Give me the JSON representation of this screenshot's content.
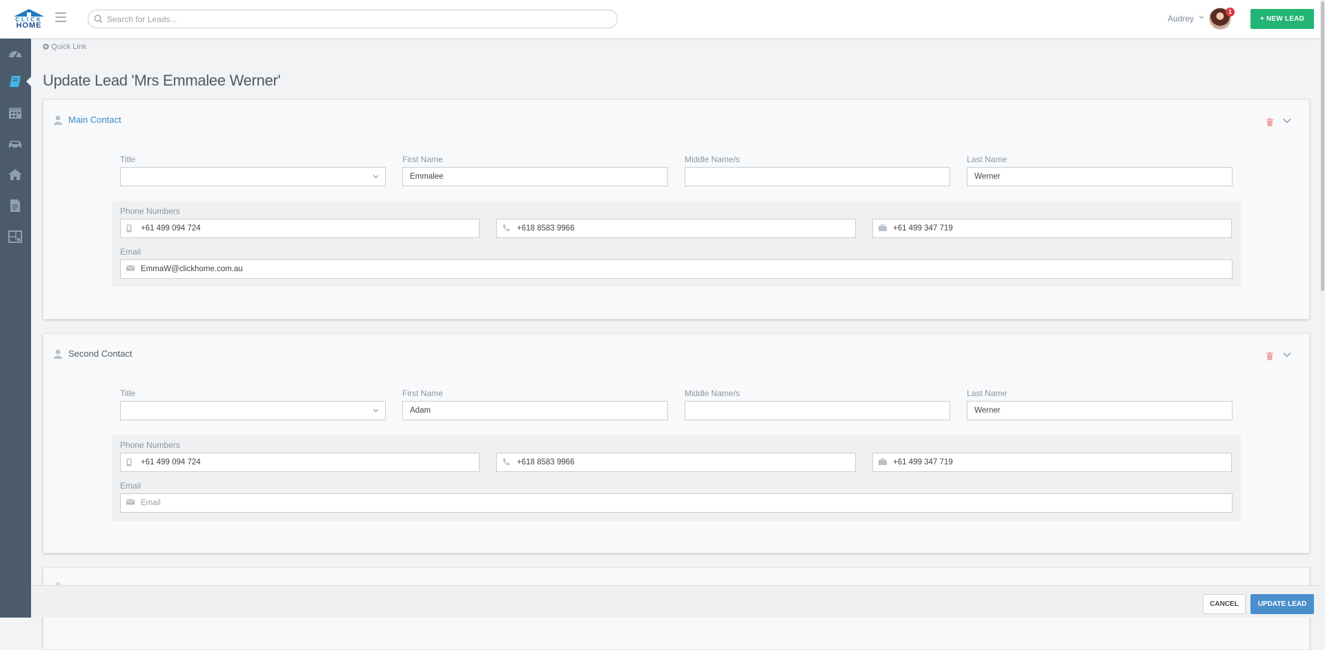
{
  "app": {
    "logo_top": "CLICK",
    "logo_bottom": "HOME",
    "search_placeholder": "Search for Leads...",
    "user_name": "Audrey",
    "notification_count": "1",
    "new_lead_label": "+ NEW LEAD"
  },
  "sidebar": {
    "items": [
      {
        "icon": "dashboard-icon"
      },
      {
        "icon": "leads-book-icon",
        "active": true
      },
      {
        "icon": "calendar-icon"
      },
      {
        "icon": "car-icon"
      },
      {
        "icon": "home-icon"
      },
      {
        "icon": "document-icon"
      },
      {
        "icon": "floorplan-icon"
      }
    ]
  },
  "page": {
    "quick_link": "Quick Link",
    "title": "Update Lead 'Mrs Emmalee Werner'"
  },
  "main_contact": {
    "heading": "Main Contact",
    "title_label": "Title",
    "title_value": "",
    "first_name_label": "First Name",
    "first_name": "Emmalee",
    "middle_name_label": "Middle Name/s",
    "middle_name": "",
    "last_name_label": "Last Name",
    "last_name": "Werner",
    "phone_label": "Phone Numbers",
    "mobile": "+61 499 094 724",
    "home_phone": "+618 8583 9966",
    "work_phone": "+61 499 347 719",
    "email_label": "Email",
    "email": "EmmaW@clickhome.com.au",
    "email_placeholder": "Email"
  },
  "second_contact": {
    "heading": "Second Contact",
    "title_label": "Title",
    "title_value": "",
    "first_name_label": "First Name",
    "first_name": "Adam",
    "middle_name_label": "Middle Name/s",
    "middle_name": "",
    "last_name_label": "Last Name",
    "last_name": "Werner",
    "phone_label": "Phone Numbers",
    "mobile": "+61 499 094 724",
    "home_phone": "+618 8583 9966",
    "work_phone": "+61 499 347 719",
    "email_label": "Email",
    "email": "",
    "email_placeholder": "Email"
  },
  "footer": {
    "cancel_label": "CANCEL",
    "update_label": "UPDATE LEAD"
  },
  "colors": {
    "brand_blue": "#1f7bc4",
    "accent_green": "#22b573",
    "primary_blue": "#4a8fcc",
    "sidebar_bg": "#4b5b6b",
    "active_icon": "#3fb8e8",
    "link_blue": "#3a87c0"
  }
}
